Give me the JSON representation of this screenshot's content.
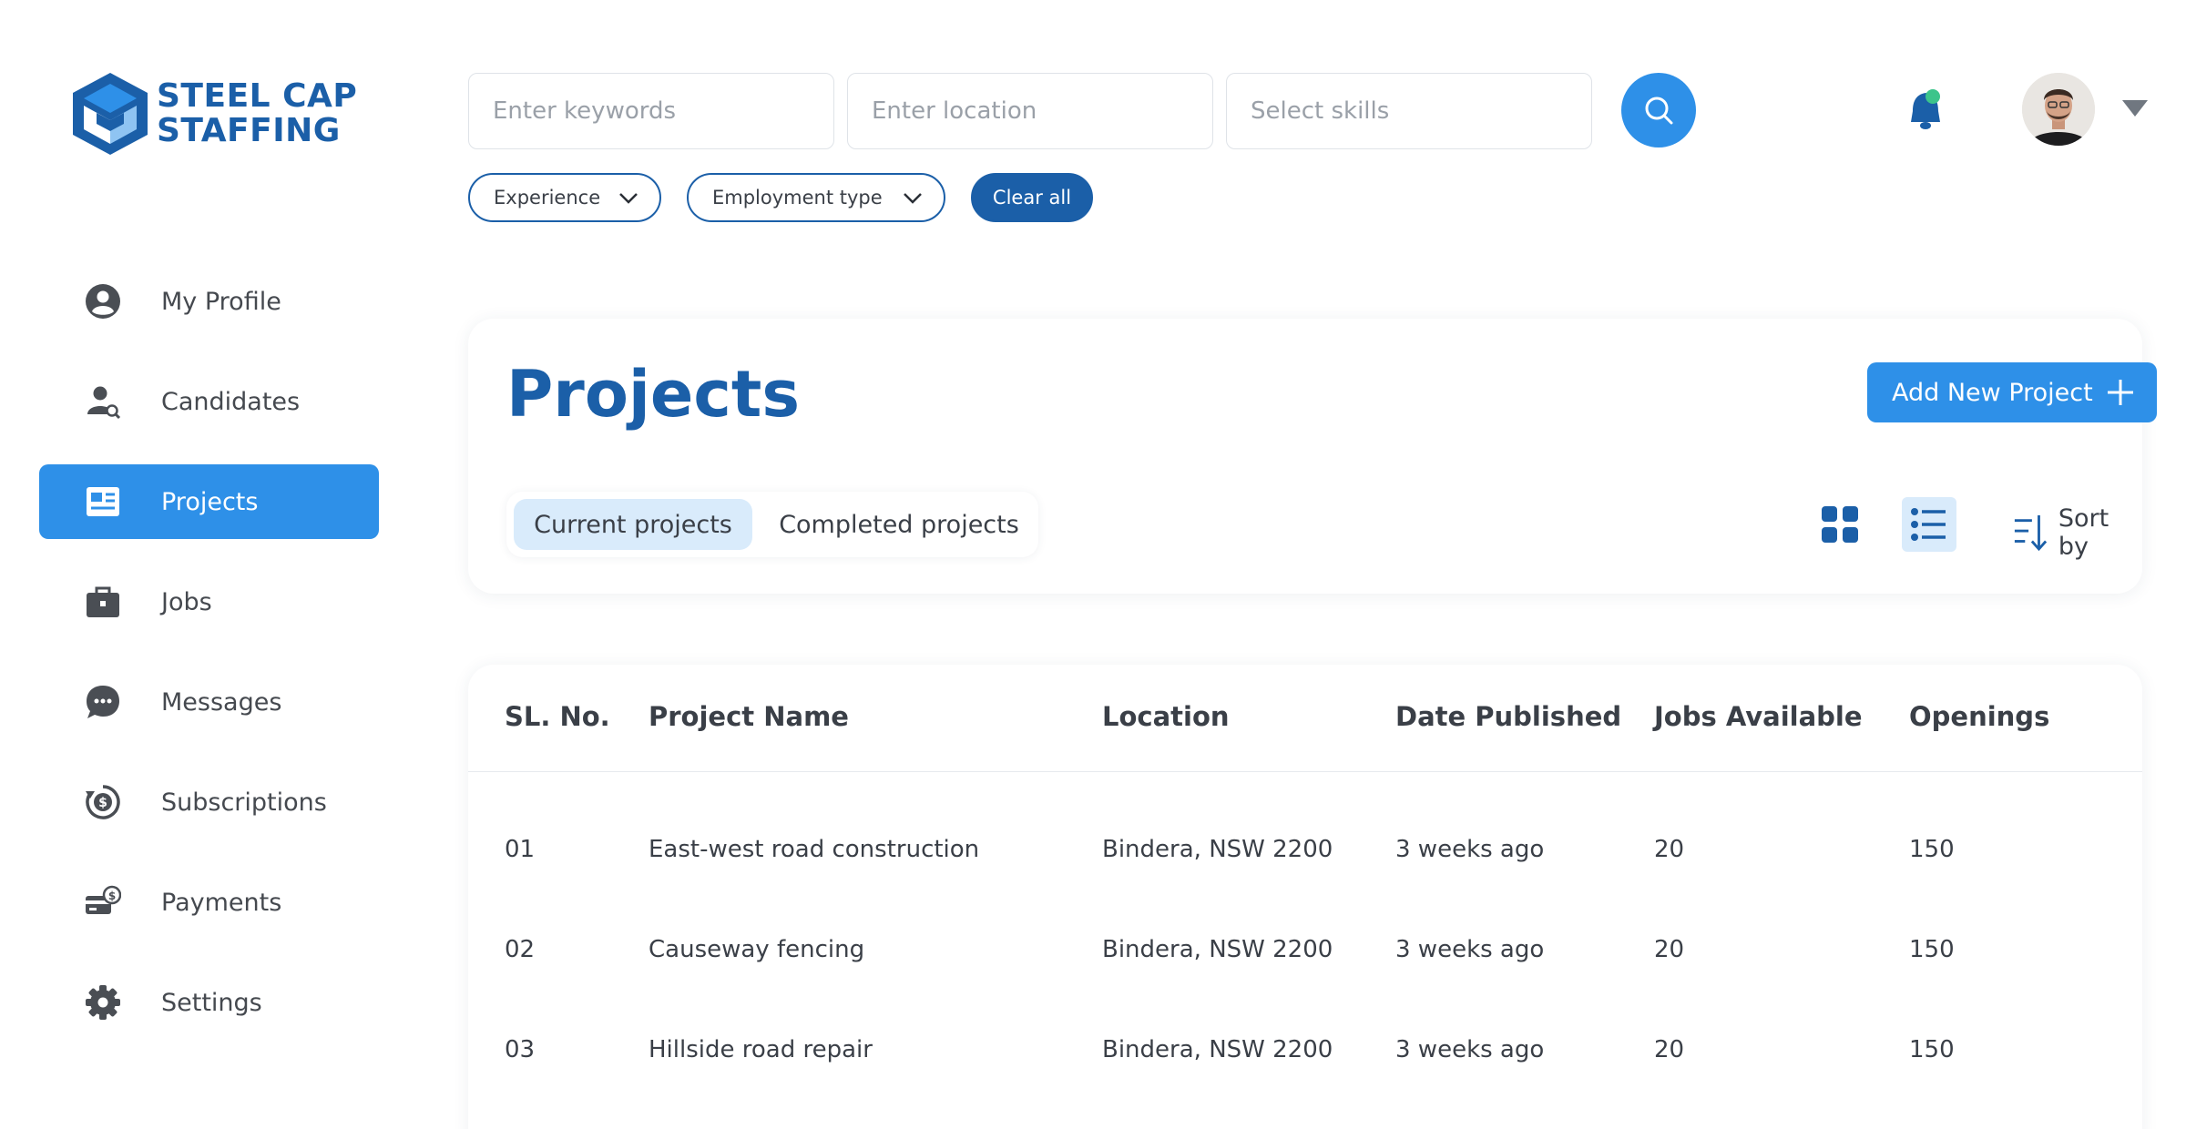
{
  "brand": {
    "line1": "STEEL CAP",
    "line2": "STAFFING",
    "color": "#1b5fa8"
  },
  "sidebar": {
    "items": [
      {
        "label": "My Profile",
        "icon": "user-circle-icon",
        "active": false
      },
      {
        "label": "Candidates",
        "icon": "candidate-search-icon",
        "active": false
      },
      {
        "label": "Projects",
        "icon": "projects-icon",
        "active": true
      },
      {
        "label": "Jobs",
        "icon": "briefcase-icon",
        "active": false
      },
      {
        "label": "Messages",
        "icon": "chat-bubble-icon",
        "active": false
      },
      {
        "label": "Subscriptions",
        "icon": "subscription-icon",
        "active": false
      },
      {
        "label": "Payments",
        "icon": "payments-icon",
        "active": false
      },
      {
        "label": "Settings",
        "icon": "gear-icon",
        "active": false
      }
    ]
  },
  "search": {
    "keywords_placeholder": "Enter keywords",
    "location_placeholder": "Enter location",
    "skills_placeholder": "Select skills"
  },
  "filters": {
    "experience": "Experience",
    "employment_type": "Employment type",
    "clear_all": "Clear all"
  },
  "projects": {
    "title": "Projects",
    "add_button": "Add New Project",
    "tabs": [
      "Current projects",
      "Completed projects"
    ],
    "active_tab": 0,
    "sort_label": "Sort by",
    "active_view": "list"
  },
  "table": {
    "headers": [
      "SL. No.",
      "Project Name",
      "Location",
      "Date Published",
      "Jobs Available",
      "Openings"
    ],
    "rows": [
      [
        "01",
        "East-west road construction",
        "Bindera, NSW 2200",
        "3 weeks ago",
        "20",
        "150"
      ],
      [
        "02",
        "Causeway fencing",
        "Bindera, NSW 2200",
        "3 weeks ago",
        "20",
        "150"
      ],
      [
        "03",
        "Hillside road repair",
        "Bindera, NSW 2200",
        "3 weeks ago",
        "20",
        "150"
      ]
    ]
  },
  "colors": {
    "primary": "#2e90e8",
    "dark_blue": "#1b5fa8",
    "light_blue": "#d9ebfb",
    "notification_dot": "#3cc48b"
  }
}
